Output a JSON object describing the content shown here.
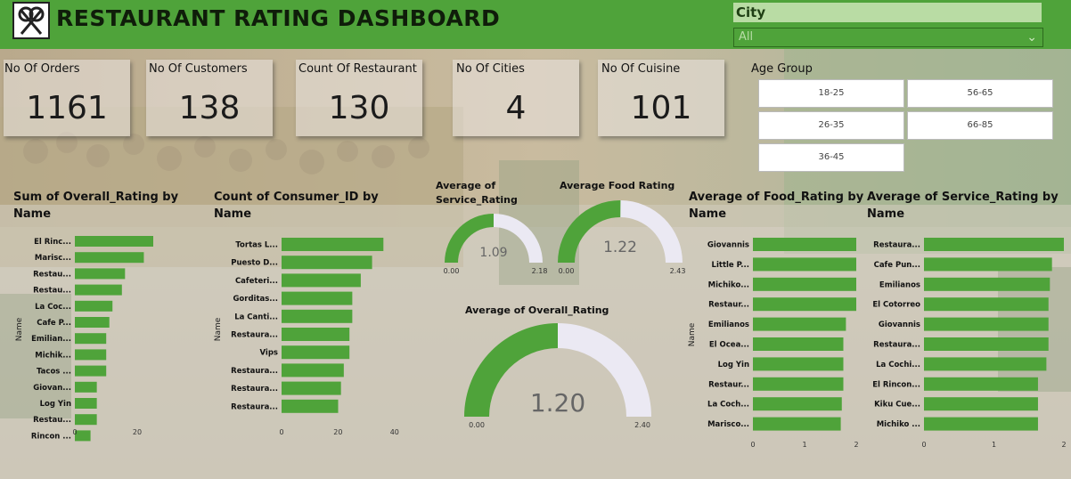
{
  "header": {
    "title": "RESTAURANT RATING DASHBOARD",
    "city_label": "City",
    "city_value": "All",
    "accent": "#4fa33a"
  },
  "kpis": [
    {
      "label": "No Of Orders",
      "value": "1161"
    },
    {
      "label": "No Of Customers",
      "value": "138"
    },
    {
      "label": "Count Of Restaurant",
      "value": "130"
    },
    {
      "label": "No Of Cities",
      "value": "4"
    },
    {
      "label": "No Of Cuisine",
      "value": "101"
    }
  ],
  "age_group": {
    "title": "Age Group",
    "options": [
      "18-25",
      "56-65",
      "26-35",
      "66-85",
      "36-45"
    ]
  },
  "charts": {
    "overall_by_name": {
      "title_l1": "Sum of Overall_Rating by",
      "title_l2": "Name",
      "ylabel": "Name",
      "ticks": [
        "0",
        "20"
      ]
    },
    "consumer_by_name": {
      "title_l1": "Count of Consumer_ID by",
      "title_l2": "Name",
      "ylabel": "Name",
      "ticks": [
        "0",
        "20",
        "40"
      ]
    },
    "food_by_name": {
      "title_l1": "Average of Food_Rating by",
      "title_l2": "Name",
      "ylabel": "Name",
      "ticks": [
        "0",
        "1",
        "2"
      ]
    },
    "service_by_name": {
      "title_l1": "Average of Service_Rating by",
      "title_l2": "Name",
      "ticks": [
        "0",
        "1",
        "2"
      ]
    },
    "gauge_service": {
      "title_l1": "Average of",
      "title_l2": "Service_Rating",
      "min": "0.00",
      "max": "2.18",
      "value_label": "1.09"
    },
    "gauge_food": {
      "title": "Average Food Rating",
      "min": "0.00",
      "max": "2.43",
      "value_label": "1.22"
    },
    "gauge_overall": {
      "title": "Average of Overall_Rating",
      "min": "0.00",
      "max": "2.40",
      "value_label": "1.20"
    }
  },
  "chart_data": [
    {
      "type": "bar",
      "title": "Sum of Overall_Rating by Name",
      "ylabel": "Name",
      "categories": [
        "El Rinc...",
        "Marisc...",
        "Restau...",
        "Restau...",
        "La Coc...",
        "Cafe P...",
        "Emilian...",
        "Michik...",
        "Tacos ...",
        "Giovan...",
        "Log Yin",
        "Restau...",
        "Rincon ..."
      ],
      "values": [
        25,
        22,
        16,
        15,
        12,
        11,
        10,
        10,
        10,
        7,
        7,
        7,
        5
      ],
      "xlim": [
        0,
        25
      ]
    },
    {
      "type": "bar",
      "title": "Count of Consumer_ID by Name",
      "ylabel": "Name",
      "categories": [
        "Tortas L...",
        "Puesto D...",
        "Cafeteri...",
        "Gorditas...",
        "La Canti...",
        "Restaura...",
        "Vips",
        "Restaura...",
        "Restaura...",
        "Restaura..."
      ],
      "values": [
        36,
        32,
        28,
        25,
        25,
        24,
        24,
        22,
        21,
        20
      ],
      "xlim": [
        0,
        40
      ]
    },
    {
      "type": "bar",
      "title": "Average of Food_Rating by Name",
      "ylabel": "Name",
      "categories": [
        "Giovannis",
        "Little P...",
        "Michiko...",
        "Restaur...",
        "Emilianos",
        "El Ocea...",
        "Log Yin",
        "Restaur...",
        "La Coch...",
        "Marisco..."
      ],
      "values": [
        2.0,
        2.0,
        2.0,
        2.0,
        1.8,
        1.75,
        1.75,
        1.75,
        1.72,
        1.7
      ],
      "xlim": [
        0,
        2
      ]
    },
    {
      "type": "bar",
      "title": "Average of Service_Rating by Name",
      "categories": [
        "Restaura...",
        "Cafe Pun...",
        "Emilianos",
        "El Cotorreo",
        "Giovannis",
        "Restaura...",
        "La Cochi...",
        "El Rincon...",
        "Kiku Cue...",
        "Michiko ..."
      ],
      "values": [
        2.0,
        1.83,
        1.8,
        1.78,
        1.78,
        1.78,
        1.75,
        1.63,
        1.63,
        1.63
      ],
      "xlim": [
        0,
        2
      ]
    },
    {
      "type": "gauge",
      "title": "Average of Service_Rating",
      "value": 1.09,
      "min": 0,
      "max": 2.18
    },
    {
      "type": "gauge",
      "title": "Average Food Rating",
      "value": 1.22,
      "min": 0,
      "max": 2.43
    },
    {
      "type": "gauge",
      "title": "Average of Overall_Rating",
      "value": 1.2,
      "min": 0,
      "max": 2.4
    }
  ]
}
